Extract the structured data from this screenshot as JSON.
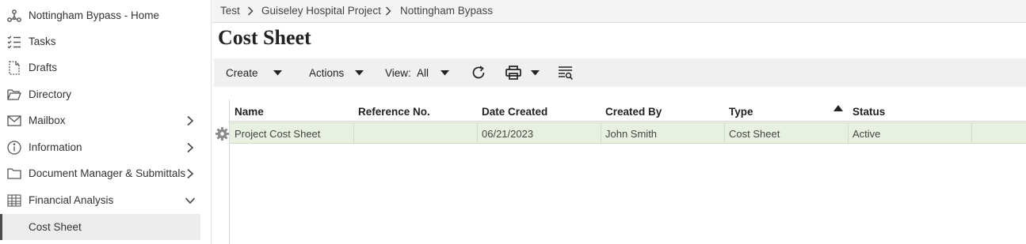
{
  "sidebar": {
    "items": [
      {
        "label": "Nottingham Bypass - Home",
        "icon": "hierarchy-icon"
      },
      {
        "label": "Tasks",
        "icon": "tasks-list-icon"
      },
      {
        "label": "Drafts",
        "icon": "drafts-icon"
      },
      {
        "label": "Directory",
        "icon": "folder-open-icon"
      },
      {
        "label": "Mailbox",
        "icon": "mail-icon",
        "chevron": "right"
      },
      {
        "label": "Information",
        "icon": "info-icon",
        "chevron": "right"
      },
      {
        "label": "Document Manager & Submittals",
        "icon": "folder-icon",
        "chevron": "right"
      },
      {
        "label": "Financial Analysis",
        "icon": "grid-icon",
        "chevron": "down"
      },
      {
        "label": "Cost Sheet",
        "active": true
      }
    ]
  },
  "breadcrumb": [
    "Test",
    "Guiseley Hospital Project",
    "Nottingham Bypass"
  ],
  "page": {
    "title": "Cost Sheet"
  },
  "toolbar": {
    "create_label": "Create",
    "actions_label": "Actions",
    "view_label": "View:",
    "view_value": "All"
  },
  "table": {
    "columns": [
      "Name",
      "Reference No.",
      "Date Created",
      "Created By",
      "Type",
      "Status"
    ],
    "sorted_column": "Type",
    "rows": [
      {
        "name": "Project Cost Sheet",
        "reference": "",
        "date": "06/21/2023",
        "created_by": "John Smith",
        "type": "Cost Sheet",
        "status": "Active"
      }
    ]
  },
  "colors": {
    "selected_row": "#e8f1e1",
    "toolbar_bg": "#f0f0f0",
    "active_nav": "#ececec"
  }
}
